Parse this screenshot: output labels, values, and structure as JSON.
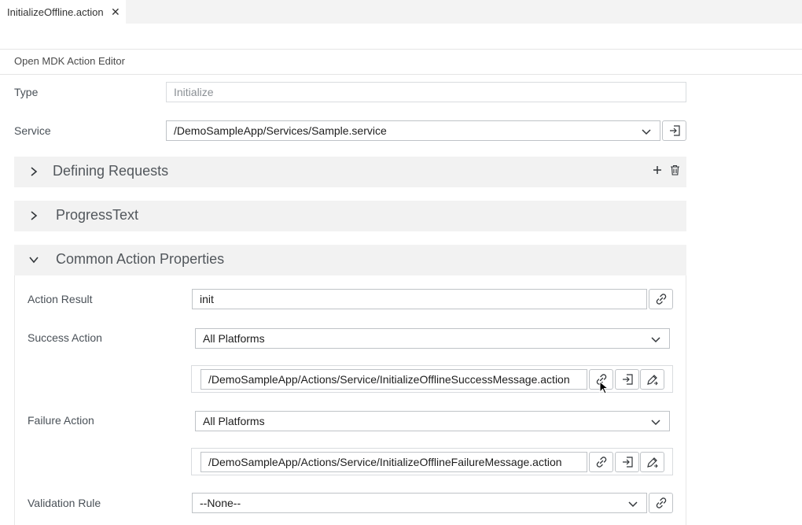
{
  "tab": {
    "title": "InitializeOffline.action",
    "close": "✕"
  },
  "editor": {
    "title": "Open MDK Action Editor"
  },
  "fields": {
    "type": {
      "label": "Type",
      "value": "Initialize"
    },
    "service": {
      "label": "Service",
      "value": "/DemoSampleApp/Services/Sample.service"
    }
  },
  "sections": {
    "defining_requests": "Defining Requests",
    "progress_text": "ProgressText",
    "common_action_properties": "Common Action Properties"
  },
  "common": {
    "action_result": {
      "label": "Action Result",
      "value": "init"
    },
    "success_action": {
      "label": "Success Action",
      "platform": "All Platforms",
      "value": "/DemoSampleApp/Actions/Service/InitializeOfflineSuccessMessage.action"
    },
    "failure_action": {
      "label": "Failure Action",
      "platform": "All Platforms",
      "value": "/DemoSampleApp/Actions/Service/InitializeOfflineFailureMessage.action"
    },
    "validation_rule": {
      "label": "Validation Rule",
      "value": "--None--"
    }
  },
  "icons": {
    "link": "link-icon",
    "open": "open-file-icon",
    "edit": "edit-icon",
    "add": "plus-icon",
    "delete": "trash-icon",
    "chevron_right": "chevron-right-icon",
    "chevron_down": "chevron-down-icon"
  }
}
